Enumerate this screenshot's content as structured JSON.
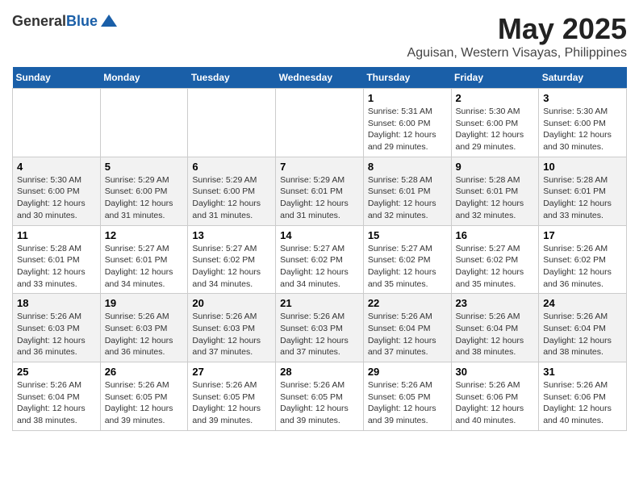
{
  "header": {
    "logo_general": "General",
    "logo_blue": "Blue",
    "title": "May 2025",
    "subtitle": "Aguisan, Western Visayas, Philippines"
  },
  "days_of_week": [
    "Sunday",
    "Monday",
    "Tuesday",
    "Wednesday",
    "Thursday",
    "Friday",
    "Saturday"
  ],
  "weeks": [
    {
      "row_class": "odd-row",
      "days": [
        {
          "date": "",
          "info": ""
        },
        {
          "date": "",
          "info": ""
        },
        {
          "date": "",
          "info": ""
        },
        {
          "date": "",
          "info": ""
        },
        {
          "date": "1",
          "info": "Sunrise: 5:31 AM\nSunset: 6:00 PM\nDaylight: 12 hours\nand 29 minutes."
        },
        {
          "date": "2",
          "info": "Sunrise: 5:30 AM\nSunset: 6:00 PM\nDaylight: 12 hours\nand 29 minutes."
        },
        {
          "date": "3",
          "info": "Sunrise: 5:30 AM\nSunset: 6:00 PM\nDaylight: 12 hours\nand 30 minutes."
        }
      ]
    },
    {
      "row_class": "even-row",
      "days": [
        {
          "date": "4",
          "info": "Sunrise: 5:30 AM\nSunset: 6:00 PM\nDaylight: 12 hours\nand 30 minutes."
        },
        {
          "date": "5",
          "info": "Sunrise: 5:29 AM\nSunset: 6:00 PM\nDaylight: 12 hours\nand 31 minutes."
        },
        {
          "date": "6",
          "info": "Sunrise: 5:29 AM\nSunset: 6:00 PM\nDaylight: 12 hours\nand 31 minutes."
        },
        {
          "date": "7",
          "info": "Sunrise: 5:29 AM\nSunset: 6:01 PM\nDaylight: 12 hours\nand 31 minutes."
        },
        {
          "date": "8",
          "info": "Sunrise: 5:28 AM\nSunset: 6:01 PM\nDaylight: 12 hours\nand 32 minutes."
        },
        {
          "date": "9",
          "info": "Sunrise: 5:28 AM\nSunset: 6:01 PM\nDaylight: 12 hours\nand 32 minutes."
        },
        {
          "date": "10",
          "info": "Sunrise: 5:28 AM\nSunset: 6:01 PM\nDaylight: 12 hours\nand 33 minutes."
        }
      ]
    },
    {
      "row_class": "odd-row",
      "days": [
        {
          "date": "11",
          "info": "Sunrise: 5:28 AM\nSunset: 6:01 PM\nDaylight: 12 hours\nand 33 minutes."
        },
        {
          "date": "12",
          "info": "Sunrise: 5:27 AM\nSunset: 6:01 PM\nDaylight: 12 hours\nand 34 minutes."
        },
        {
          "date": "13",
          "info": "Sunrise: 5:27 AM\nSunset: 6:02 PM\nDaylight: 12 hours\nand 34 minutes."
        },
        {
          "date": "14",
          "info": "Sunrise: 5:27 AM\nSunset: 6:02 PM\nDaylight: 12 hours\nand 34 minutes."
        },
        {
          "date": "15",
          "info": "Sunrise: 5:27 AM\nSunset: 6:02 PM\nDaylight: 12 hours\nand 35 minutes."
        },
        {
          "date": "16",
          "info": "Sunrise: 5:27 AM\nSunset: 6:02 PM\nDaylight: 12 hours\nand 35 minutes."
        },
        {
          "date": "17",
          "info": "Sunrise: 5:26 AM\nSunset: 6:02 PM\nDaylight: 12 hours\nand 36 minutes."
        }
      ]
    },
    {
      "row_class": "even-row",
      "days": [
        {
          "date": "18",
          "info": "Sunrise: 5:26 AM\nSunset: 6:03 PM\nDaylight: 12 hours\nand 36 minutes."
        },
        {
          "date": "19",
          "info": "Sunrise: 5:26 AM\nSunset: 6:03 PM\nDaylight: 12 hours\nand 36 minutes."
        },
        {
          "date": "20",
          "info": "Sunrise: 5:26 AM\nSunset: 6:03 PM\nDaylight: 12 hours\nand 37 minutes."
        },
        {
          "date": "21",
          "info": "Sunrise: 5:26 AM\nSunset: 6:03 PM\nDaylight: 12 hours\nand 37 minutes."
        },
        {
          "date": "22",
          "info": "Sunrise: 5:26 AM\nSunset: 6:04 PM\nDaylight: 12 hours\nand 37 minutes."
        },
        {
          "date": "23",
          "info": "Sunrise: 5:26 AM\nSunset: 6:04 PM\nDaylight: 12 hours\nand 38 minutes."
        },
        {
          "date": "24",
          "info": "Sunrise: 5:26 AM\nSunset: 6:04 PM\nDaylight: 12 hours\nand 38 minutes."
        }
      ]
    },
    {
      "row_class": "odd-row",
      "days": [
        {
          "date": "25",
          "info": "Sunrise: 5:26 AM\nSunset: 6:04 PM\nDaylight: 12 hours\nand 38 minutes."
        },
        {
          "date": "26",
          "info": "Sunrise: 5:26 AM\nSunset: 6:05 PM\nDaylight: 12 hours\nand 39 minutes."
        },
        {
          "date": "27",
          "info": "Sunrise: 5:26 AM\nSunset: 6:05 PM\nDaylight: 12 hours\nand 39 minutes."
        },
        {
          "date": "28",
          "info": "Sunrise: 5:26 AM\nSunset: 6:05 PM\nDaylight: 12 hours\nand 39 minutes."
        },
        {
          "date": "29",
          "info": "Sunrise: 5:26 AM\nSunset: 6:05 PM\nDaylight: 12 hours\nand 39 minutes."
        },
        {
          "date": "30",
          "info": "Sunrise: 5:26 AM\nSunset: 6:06 PM\nDaylight: 12 hours\nand 40 minutes."
        },
        {
          "date": "31",
          "info": "Sunrise: 5:26 AM\nSunset: 6:06 PM\nDaylight: 12 hours\nand 40 minutes."
        }
      ]
    }
  ]
}
